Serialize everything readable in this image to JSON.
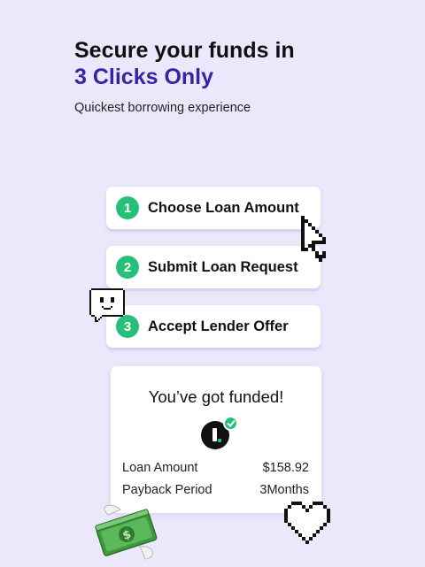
{
  "header": {
    "title_line1": "Secure your funds in",
    "title_line2": "3 Clicks Only",
    "subtitle": "Quickest borrowing experience"
  },
  "steps": [
    {
      "number": "1",
      "label": "Choose Loan Amount"
    },
    {
      "number": "2",
      "label": "Submit Loan Request"
    },
    {
      "number": "3",
      "label": "Accept Lender Offer"
    }
  ],
  "funded_card": {
    "title": "You’ve got funded!",
    "rows": [
      {
        "label": "Loan Amount",
        "value": "$158.92"
      },
      {
        "label": "Payback Period",
        "value": "3Months"
      }
    ]
  },
  "colors": {
    "background": "#ebe8fb",
    "accent": "#3a22a6",
    "step_badge": "#27c07a",
    "card": "#ffffff"
  },
  "icons": [
    "pixel-cursor-icon",
    "pixel-chat-face-icon",
    "lender-logo-icon",
    "check-badge-icon",
    "pixel-heart-icon",
    "money-bill-icon"
  ]
}
